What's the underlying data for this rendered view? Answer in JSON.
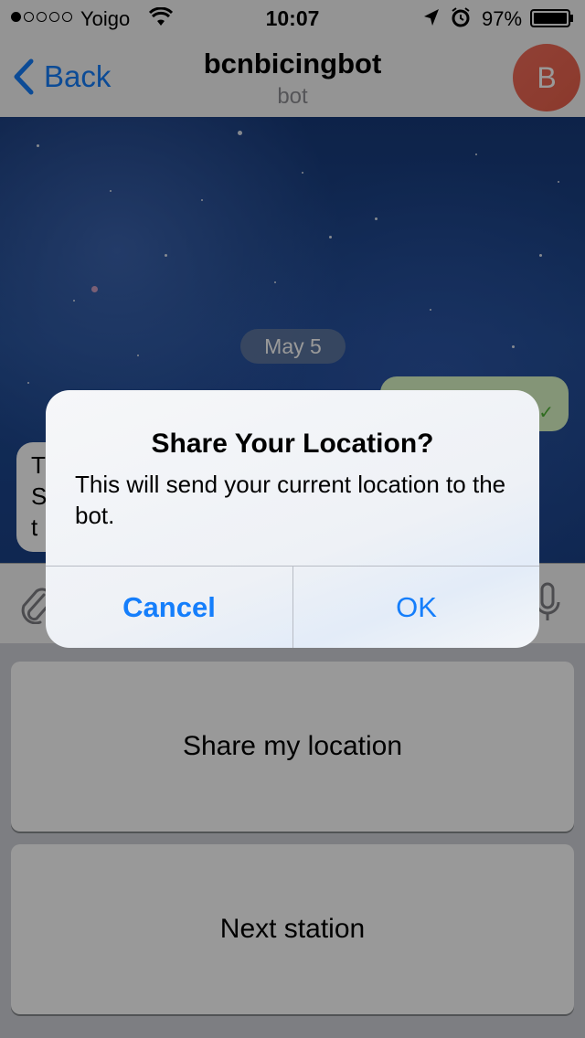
{
  "status_bar": {
    "carrier": "Yoigo",
    "time": "10:07",
    "battery_percent": "97%",
    "signal_bars_filled": 1,
    "signal_bars_total": 5,
    "icons": [
      "wifi-icon",
      "location-arrow-icon",
      "alarm-icon",
      "battery-icon"
    ]
  },
  "nav": {
    "back_label": "Back",
    "title": "bcnbicingbot",
    "subtitle": "bot",
    "avatar_initial": "B"
  },
  "chat": {
    "date_label": "May 5",
    "outgoing_checks": "✓✓",
    "incoming_partial_lines": [
      "T",
      "S",
      "t"
    ]
  },
  "input_bar": {
    "icons": [
      "paperclip-icon",
      "microphone-icon"
    ]
  },
  "keyboard": {
    "buttons": [
      {
        "label": "Share my location"
      },
      {
        "label": "Next station"
      }
    ]
  },
  "alert": {
    "title": "Share Your Location?",
    "message": "This will send your current location to the bot.",
    "cancel_label": "Cancel",
    "ok_label": "OK"
  },
  "colors": {
    "accent": "#157efb",
    "avatar": "#ef6a56",
    "outgoing_bubble": "#dcf8c6"
  }
}
